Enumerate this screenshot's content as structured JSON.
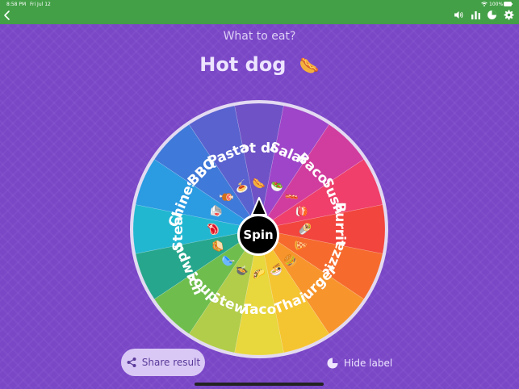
{
  "status_bar": {
    "time": "8:58 PM",
    "date": "Fri Jul 12",
    "battery": "100%"
  },
  "toolbar": {
    "back_icon": "chevron-left-icon",
    "right_icons": [
      "speaker-icon",
      "bar-chart-icon",
      "pie-chart-icon",
      "gear-icon"
    ],
    "bar_color": "#43a047"
  },
  "title": "What to eat?",
  "result": {
    "label": "Hot dog",
    "emoji": "🌭"
  },
  "wheel": {
    "segments": [
      {
        "label": "Hot dog",
        "emoji": "🌭",
        "color": "#6f52c6"
      },
      {
        "label": "Salad",
        "emoji": "🥗",
        "color": "#9e45c9"
      },
      {
        "label": "Bacon",
        "emoji": "🥓",
        "color": "#d13d9e"
      },
      {
        "label": "Sushi",
        "emoji": "🍣",
        "color": "#ef3f6a"
      },
      {
        "label": "Burrito",
        "emoji": "🌯",
        "color": "#f2453d"
      },
      {
        "label": "Pizza",
        "emoji": "🍕",
        "color": "#f66b2d"
      },
      {
        "label": "Burger",
        "emoji": "🍔",
        "color": "#f7952c"
      },
      {
        "label": "Thai",
        "emoji": "🍜",
        "color": "#f5c431"
      },
      {
        "label": "Taco",
        "emoji": "🌮",
        "color": "#e8d73d"
      },
      {
        "label": "Stew",
        "emoji": "🍲",
        "color": "#b2cd49"
      },
      {
        "label": "Soup",
        "emoji": "🥣",
        "color": "#6fbe4d"
      },
      {
        "label": "Sandwich",
        "emoji": "🥪",
        "color": "#26a68c"
      },
      {
        "label": "Steak",
        "emoji": "🥩",
        "color": "#22b7d1"
      },
      {
        "label": "Chinese",
        "emoji": "🥡",
        "color": "#2b9be2"
      },
      {
        "label": "BBQ",
        "emoji": "🍖",
        "color": "#3f79d9"
      },
      {
        "label": "Pasta",
        "emoji": "🍝",
        "color": "#5962cf"
      }
    ],
    "rim_color": "#eeeaf6"
  },
  "spin_label": "Spin",
  "share_label": "Share result",
  "hide_label": "Hide label"
}
